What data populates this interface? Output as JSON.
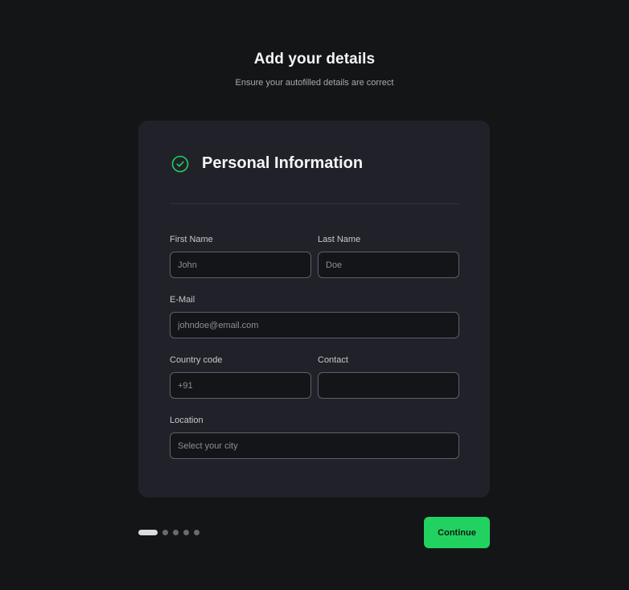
{
  "header": {
    "title": "Add your details",
    "subtitle": "Ensure your autofilled details are correct"
  },
  "card": {
    "title": "Personal Information",
    "icon": "check-circle-icon",
    "accent_color": "#22d260"
  },
  "form": {
    "first_name": {
      "label": "First Name",
      "value": "",
      "placeholder": "John"
    },
    "last_name": {
      "label": "Last Name",
      "value": "",
      "placeholder": "Doe"
    },
    "email": {
      "label": "E-Mail",
      "value": "",
      "placeholder": "johndoe@email.com"
    },
    "country_code": {
      "label": "Country code",
      "value": "",
      "placeholder": "+91"
    },
    "contact": {
      "label": "Contact",
      "value": "",
      "placeholder": ""
    },
    "location": {
      "label": "Location",
      "value": "",
      "placeholder": "Select your city"
    }
  },
  "pager": {
    "total_steps": 5,
    "current_step": 1
  },
  "actions": {
    "continue_label": "Continue",
    "continue_color": "#22d260"
  }
}
